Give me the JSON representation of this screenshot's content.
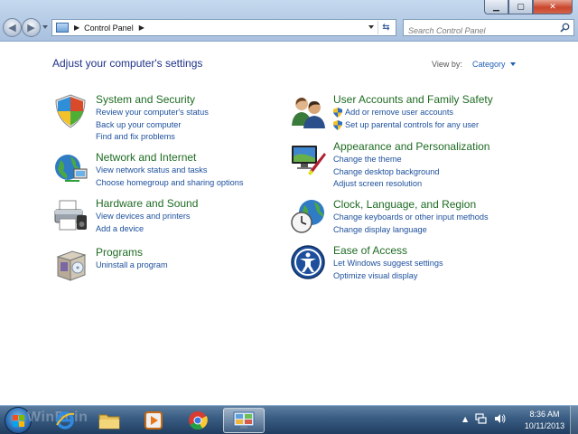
{
  "window": {
    "buttons": {
      "minimize": "▁",
      "maximize": "▢",
      "close": "✕"
    }
  },
  "nav": {
    "back_icon": "back-arrow-icon",
    "forward_icon": "forward-arrow-icon",
    "address": {
      "location": "Control Panel"
    },
    "search": {
      "placeholder": "Search Control Panel"
    }
  },
  "main": {
    "heading": "Adjust your computer's settings",
    "view_by_label": "View by:",
    "view_by_value": "Category",
    "categories_left": [
      {
        "title": "System and Security",
        "icon": "shield-icon",
        "links": [
          "Review your computer's status",
          "Back up your computer",
          "Find and fix problems"
        ]
      },
      {
        "title": "Network and Internet",
        "icon": "network-globe-icon",
        "links": [
          "View network status and tasks",
          "Choose homegroup and sharing options"
        ]
      },
      {
        "title": "Hardware and Sound",
        "icon": "printer-icon",
        "links": [
          "View devices and printers",
          "Add a device"
        ]
      },
      {
        "title": "Programs",
        "icon": "programs-box-icon",
        "links": [
          "Uninstall a program"
        ]
      }
    ],
    "categories_right": [
      {
        "title": "User Accounts and Family Safety",
        "icon": "users-icon",
        "links": [
          "Add or remove user accounts",
          "Set up parental controls for any user"
        ]
      },
      {
        "title": "Appearance and Personalization",
        "icon": "monitor-paint-icon",
        "links": [
          "Change the theme",
          "Change desktop background",
          "Adjust screen resolution"
        ]
      },
      {
        "title": "Clock, Language, and Region",
        "icon": "clock-globe-icon",
        "links": [
          "Change keyboards or other input methods",
          "Change display language"
        ]
      },
      {
        "title": "Ease of Access",
        "icon": "ease-of-access-icon",
        "links": [
          "Let Windows suggest settings",
          "Optimize visual display"
        ]
      }
    ]
  },
  "taskbar": {
    "watermark": "WinPoin",
    "pinned": [
      "internet-explorer-icon",
      "windows-explorer-icon",
      "media-player-icon",
      "chrome-icon",
      "control-panel-icon"
    ],
    "tray": {
      "time": "8:36 AM",
      "date": "10/11/2013"
    }
  }
}
